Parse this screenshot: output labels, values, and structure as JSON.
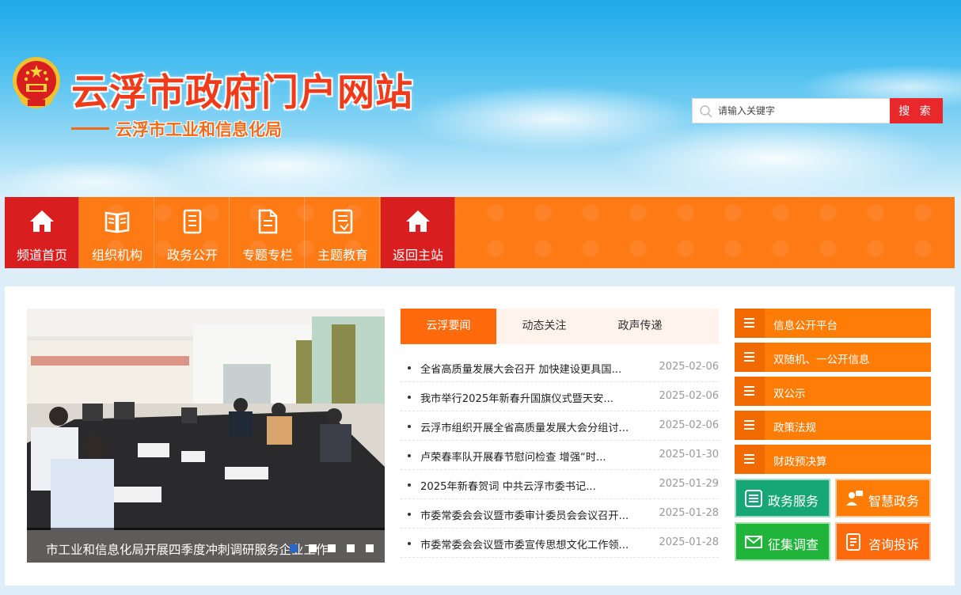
{
  "header": {
    "site_title": "云浮市政府门户网站",
    "department": "云浮市工业和信息化局",
    "emblem_icon": "national-emblem-icon",
    "search": {
      "placeholder": "请输入关键字",
      "button_label": "搜 索",
      "icon": "search-icon"
    }
  },
  "nav": {
    "items": [
      {
        "label": "频道首页",
        "icon": "home-icon",
        "active": true
      },
      {
        "label": "组织机构",
        "icon": "book-icon",
        "active": false
      },
      {
        "label": "政务公开",
        "icon": "document-icon",
        "active": false
      },
      {
        "label": "专题专栏",
        "icon": "file-icon",
        "active": false
      },
      {
        "label": "主题教育",
        "icon": "notebook-icon",
        "active": false
      },
      {
        "label": "返回主站",
        "icon": "home-icon",
        "active": true
      }
    ]
  },
  "slideshow": {
    "caption": "市工业和信息化局开展四季度冲刺调研服务企业工作",
    "slide_count": 5,
    "active_index": 0
  },
  "news": {
    "tabs": [
      "云浮要闻",
      "动态关注",
      "政声传递"
    ],
    "active_tab": 0,
    "items": [
      {
        "title": "全省高质量发展大会召开 加快建设更具国...",
        "date": "2025-02-06"
      },
      {
        "title": "我市举行2025年新春升国旗仪式暨天安...",
        "date": "2025-02-06"
      },
      {
        "title": "云浮市组织开展全省高质量发展大会分组讨...",
        "date": "2025-02-06"
      },
      {
        "title": "卢荣春率队开展春节慰问检查 增强“时...",
        "date": "2025-01-30"
      },
      {
        "title": "2025年新春贺词 中共云浮市委书记...",
        "date": "2025-01-29"
      },
      {
        "title": "市委常委会会议暨市委审计委员会会议召开...",
        "date": "2025-01-28"
      },
      {
        "title": "市委常委会会议暨市委宣传思想文化工作领...",
        "date": "2025-01-28"
      }
    ]
  },
  "side_links": [
    {
      "label": "信息公开平台",
      "icon": "list-icon"
    },
    {
      "label": "双随机、一公开信息",
      "icon": "list-icon"
    },
    {
      "label": "双公示",
      "icon": "list-icon"
    },
    {
      "label": "政策法规",
      "icon": "list-icon"
    },
    {
      "label": "财政预决算",
      "icon": "list-icon"
    }
  ],
  "tiles": [
    {
      "label": "政务服务",
      "icon": "service-list-icon",
      "color": "#17a676"
    },
    {
      "label": "智慧政务",
      "icon": "user-chat-icon",
      "color": "#ff7d06"
    },
    {
      "label": "征集调查",
      "icon": "mail-icon",
      "color": "#21b43a"
    },
    {
      "label": "咨询投诉",
      "icon": "edit-document-icon",
      "color": "#ff6a0d"
    }
  ],
  "colors": {
    "nav_bg": "#fe7a14",
    "nav_active": "#d81e1e",
    "accent": "#ff6a0d",
    "search_btn": "#e8282b"
  }
}
